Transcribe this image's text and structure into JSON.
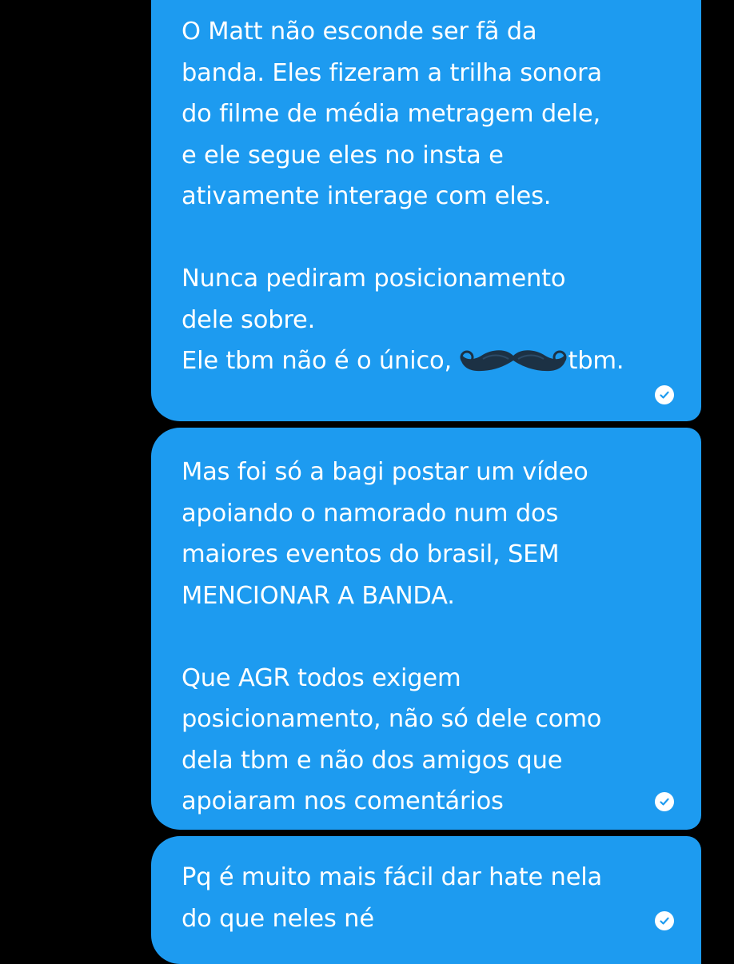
{
  "colors": {
    "background": "#000000",
    "bubble": "#1d9bf0",
    "text": "#ffffff",
    "redaction_mark": "#1c3144"
  },
  "messages": [
    {
      "lines": [
        "O Matt não esconde ser fã da",
        "banda. Eles fizeram a trilha sonora",
        "do filme de média metragem dele,",
        "e ele segue eles no insta e",
        "ativamente interage com eles.",
        "",
        "Nunca pediram posicionamento",
        "dele sobre."
      ],
      "last_line_before": "Ele tbm não é o único,",
      "last_line_after": "tbm.",
      "redaction_icon": "mustache-icon",
      "status_icon": "read-check-icon"
    },
    {
      "lines": [
        "Mas foi só a bagi postar um vídeo",
        "apoiando o namorado num dos",
        "maiores eventos do brasil, SEM",
        "MENCIONAR A BANDA.",
        "",
        "Que AGR todos exigem",
        "posicionamento, não só dele como",
        "dela tbm e não dos amigos que",
        "apoiaram nos comentários"
      ],
      "status_icon": "read-check-icon"
    },
    {
      "lines": [
        "Pq é muito mais fácil dar hate nela",
        "do que neles né"
      ],
      "status_icon": "read-check-icon"
    }
  ]
}
